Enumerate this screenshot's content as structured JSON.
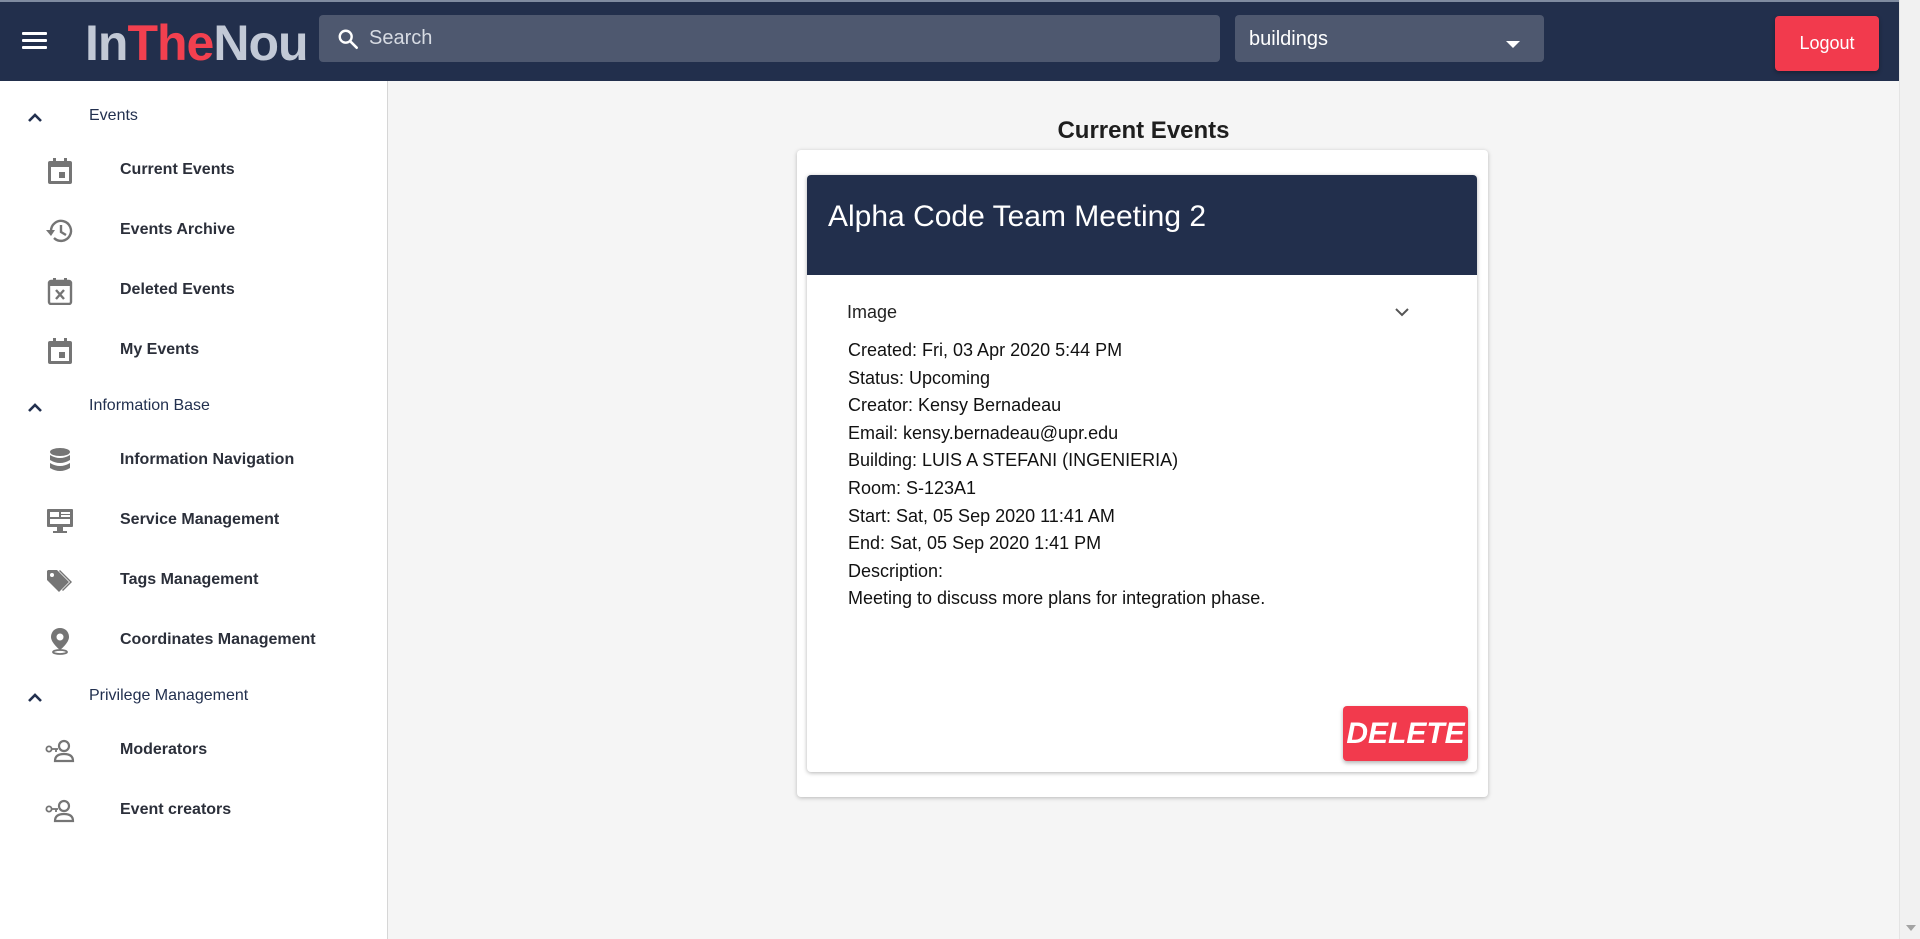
{
  "header": {
    "logo_part1": "In",
    "logo_part2": "The",
    "logo_part3": "Nou",
    "search_placeholder": "Search",
    "select_value": "buildings",
    "logout_label": "Logout"
  },
  "sidebar": {
    "groups": [
      {
        "label": "Events",
        "items": [
          {
            "label": "Current Events",
            "icon": "calendar-icon"
          },
          {
            "label": "Events Archive",
            "icon": "history-icon"
          },
          {
            "label": "Deleted Events",
            "icon": "calendar-remove-icon"
          },
          {
            "label": "My Events",
            "icon": "calendar-icon"
          }
        ]
      },
      {
        "label": "Information Base",
        "items": [
          {
            "label": "Information Navigation",
            "icon": "database-icon"
          },
          {
            "label": "Service Management",
            "icon": "monitor-icon"
          },
          {
            "label": "Tags Management",
            "icon": "tags-icon"
          },
          {
            "label": "Coordinates Management",
            "icon": "location-pin-icon"
          }
        ]
      },
      {
        "label": "Privilege Management",
        "items": [
          {
            "label": "Moderators",
            "icon": "user-key-icon"
          },
          {
            "label": "Event creators",
            "icon": "user-key-icon"
          }
        ]
      }
    ]
  },
  "main": {
    "page_title": "Current Events",
    "event": {
      "title": "Alpha Code Team Meeting 2",
      "panel_label": "Image",
      "created": "Created: Fri, 03 Apr 2020 5:44 PM",
      "status": "Status: Upcoming",
      "creator": "Creator: Kensy Bernadeau",
      "email": "Email: kensy.bernadeau@upr.edu",
      "building": "Building: LUIS A STEFANI (INGENIERIA)",
      "room": "Room: S-123A1",
      "start": "Start: Sat, 05 Sep 2020 11:41 AM",
      "end": "End: Sat, 05 Sep 2020 1:41 PM",
      "description_label": "Description:",
      "description": "Meeting to discuss more plans for integration phase.",
      "delete_label": "DELETE"
    }
  },
  "colors": {
    "navy": "#222f4c",
    "accent_red": "#f23a4d",
    "search_bg": "#4e586f"
  }
}
